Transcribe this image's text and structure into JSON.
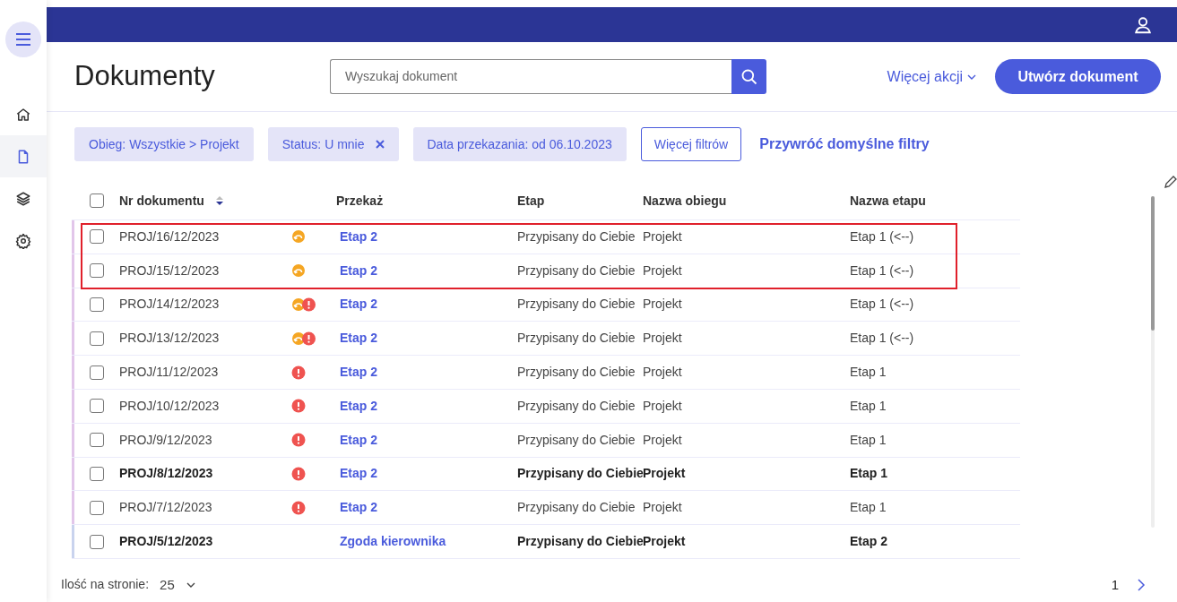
{
  "sidebar": {
    "items": [
      {
        "selected": false
      },
      {
        "selected": true
      },
      {
        "selected": false
      },
      {
        "selected": false
      }
    ]
  },
  "header": {
    "title": "Dokumenty",
    "search": {
      "placeholder": "Wyszukaj dokument"
    },
    "more_actions": "Więcej akcji",
    "create_button": "Utwórz dokument"
  },
  "filters": {
    "chips": [
      {
        "label": "Obieg: Wszystkie > Projekt",
        "removable": false
      },
      {
        "label": "Status: U mnie",
        "removable": true
      },
      {
        "label": "Data przekazania: od 06.10.2023",
        "removable": false
      }
    ],
    "more_filters": "Więcej filtrów",
    "reset": "Przywróć domyślne filtry"
  },
  "table": {
    "select_all_checked": false,
    "columns": [
      "Nr dokumentu",
      "Przekaż",
      "Etap",
      "Nazwa obiegu",
      "Nazwa etapu"
    ],
    "rows": [
      {
        "number": "PROJ/16/12/2023",
        "kind": "return",
        "forward": "Etap 2",
        "stage": "Przypisany do Ciebie",
        "workflow": "Projekt",
        "stage_name": "Etap 1 (<--)",
        "bold": false,
        "checked": false,
        "highlighted": true,
        "color": "#e2c6ea"
      },
      {
        "number": "PROJ/15/12/2023",
        "kind": "return",
        "forward": "Etap 2",
        "stage": "Przypisany do Ciebie",
        "workflow": "Projekt",
        "stage_name": "Etap 1 (<--)",
        "bold": false,
        "checked": false,
        "highlighted": true,
        "color": "#e2c6ea"
      },
      {
        "number": "PROJ/14/12/2023",
        "kind": "return_alert",
        "forward": "Etap 2",
        "stage": "Przypisany do Ciebie",
        "workflow": "Projekt",
        "stage_name": "Etap 1 (<--)",
        "bold": false,
        "checked": false,
        "highlighted": false,
        "color": "#e2c6ea"
      },
      {
        "number": "PROJ/13/12/2023",
        "kind": "return_alert",
        "forward": "Etap 2",
        "stage": "Przypisany do Ciebie",
        "workflow": "Projekt",
        "stage_name": "Etap 1 (<--)",
        "bold": false,
        "checked": false,
        "highlighted": false,
        "color": "#e2c6ea"
      },
      {
        "number": "PROJ/11/12/2023",
        "kind": "alert",
        "forward": "Etap 2",
        "stage": "Przypisany do Ciebie",
        "workflow": "Projekt",
        "stage_name": "Etap 1",
        "bold": false,
        "checked": false,
        "highlighted": false,
        "color": "#e2c6ea"
      },
      {
        "number": "PROJ/10/12/2023",
        "kind": "alert",
        "forward": "Etap 2",
        "stage": "Przypisany do Ciebie",
        "workflow": "Projekt",
        "stage_name": "Etap 1",
        "bold": false,
        "checked": false,
        "highlighted": false,
        "color": "#e2c6ea"
      },
      {
        "number": "PROJ/9/12/2023",
        "kind": "alert",
        "forward": "Etap 2",
        "stage": "Przypisany do Ciebie",
        "workflow": "Projekt",
        "stage_name": "Etap 1",
        "bold": false,
        "checked": false,
        "highlighted": false,
        "color": "#e2c6ea"
      },
      {
        "number": "PROJ/8/12/2023",
        "kind": "alert",
        "forward": "Etap 2",
        "stage": "Przypisany do Ciebie",
        "workflow": "Projekt",
        "stage_name": "Etap 1",
        "bold": true,
        "checked": false,
        "highlighted": false,
        "color": "#e2c6ea"
      },
      {
        "number": "PROJ/7/12/2023",
        "kind": "alert",
        "forward": "Etap 2",
        "stage": "Przypisany do Ciebie",
        "workflow": "Projekt",
        "stage_name": "Etap 1",
        "bold": false,
        "checked": false,
        "highlighted": false,
        "color": "#e2c6ea"
      },
      {
        "number": "PROJ/5/12/2023",
        "kind": "none",
        "forward": "Zgoda kierownika",
        "stage": "Przypisany do Ciebie",
        "workflow": "Projekt",
        "stage_name": "Etap 2",
        "bold": true,
        "checked": false,
        "highlighted": false,
        "color": "#c9d3ee"
      }
    ]
  },
  "pagination": {
    "label": "Ilość na stronie:",
    "page_size": "25",
    "page": "1"
  }
}
